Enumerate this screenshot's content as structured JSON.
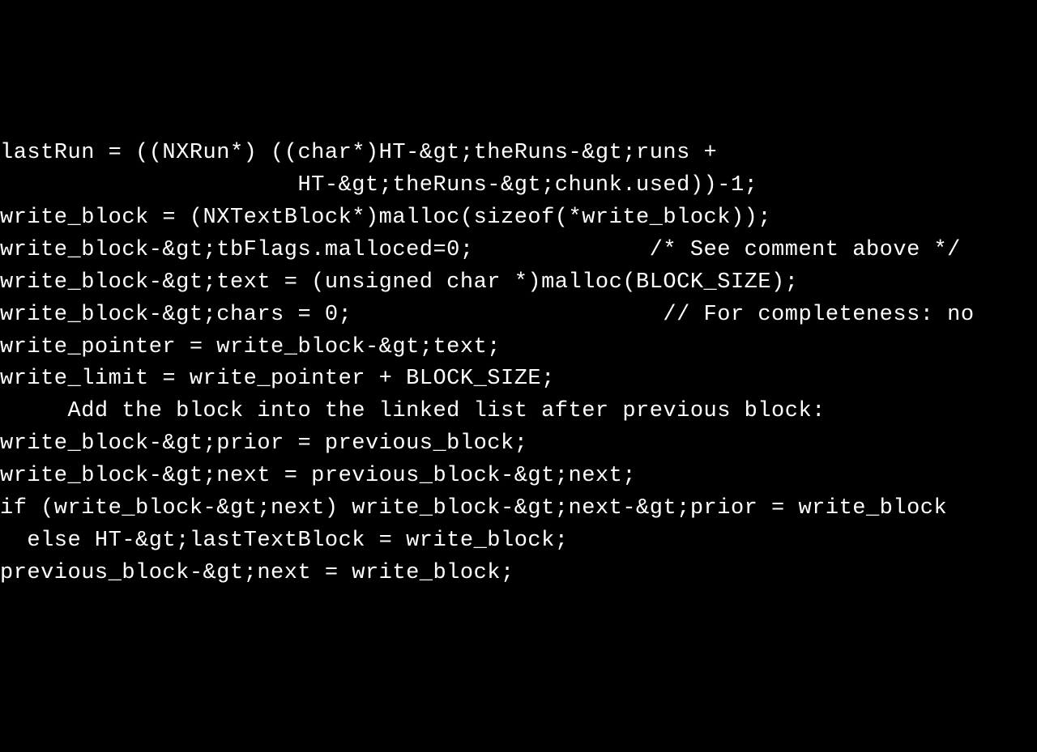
{
  "code": {
    "lines": [
      "lastRun = ((NXRun*) ((char*)HT-&gt;theRuns-&gt;runs +",
      "                      HT-&gt;theRuns-&gt;chunk.used))-1;",
      "write_block = (NXTextBlock*)malloc(sizeof(*write_block));",
      "write_block-&gt;tbFlags.malloced=0;             /* See comment above */",
      "write_block-&gt;text = (unsigned char *)malloc(BLOCK_SIZE);",
      "write_block-&gt;chars = 0;                       // For completeness: no",
      "write_pointer = write_block-&gt;text;",
      "write_limit = write_pointer + BLOCK_SIZE;",
      "     Add the block into the linked list after previous block:",
      "write_block-&gt;prior = previous_block;",
      "write_block-&gt;next = previous_block-&gt;next;",
      "if (write_block-&gt;next) write_block-&gt;next-&gt;prior = write_block",
      "  else HT-&gt;lastTextBlock = write_block;",
      "previous_block-&gt;next = write_block;"
    ]
  }
}
